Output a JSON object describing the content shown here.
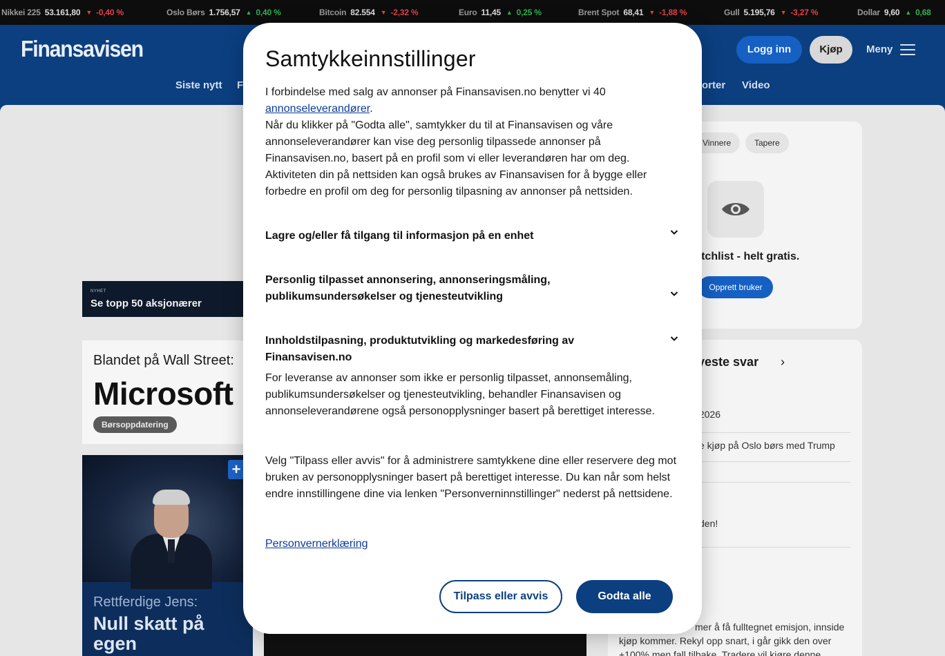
{
  "ticker": [
    {
      "name": "Nikkei 225",
      "value": "53.161,80",
      "change": "-0,40 %",
      "direction": "down"
    },
    {
      "name": "Oslo Børs",
      "value": "1.756,57",
      "change": "0,40 %",
      "direction": "up"
    },
    {
      "name": "Bitcoin",
      "value": "82.554",
      "change": "-2,32 %",
      "direction": "down"
    },
    {
      "name": "Euro",
      "value": "11,45",
      "change": "0,25 %",
      "direction": "up"
    },
    {
      "name": "Brent Spot",
      "value": "68,41",
      "change": "-1,88 %",
      "direction": "down"
    },
    {
      "name": "Gull",
      "value": "5.195,76",
      "change": "-3,27 %",
      "direction": "down"
    },
    {
      "name": "Dollar",
      "value": "9,60",
      "change": "0,68",
      "direction": "up"
    }
  ],
  "header": {
    "logo": "Finansavisen",
    "login_label": "Logg inn",
    "buy_label": "Kjøp",
    "menu_label": "Meny",
    "nav": [
      "Siste nytt",
      "F",
      "orter",
      "Video"
    ]
  },
  "promo": {
    "kicker": "NYHET",
    "title": "Se topp 50 aksjonærer"
  },
  "card1": {
    "kicker": "Blandet på Wall Street:",
    "title": "Microsoft",
    "tag": "Børsoppdatering"
  },
  "card2": {
    "badge": "+",
    "kicker": "Rettferdige Jens:",
    "title": "Null skatt på egen kjempeformue"
  },
  "watchlist": {
    "chips": [
      "Vinnere",
      "Tapere"
    ],
    "text": "en watchlist - helt gratis.",
    "button": "Opprett bruker"
  },
  "forum": {
    "title": "yeste svar",
    "rows": [
      "/2026",
      "e kjøp på Oslo børs med Trump",
      "den!",
      "mer å få fulltegnet emisjon, innside kjøp kommer. Rekyl opp snart, i går gikk den over +100% men fall tilbake. Tradere vil kjøre denne"
    ]
  },
  "consent": {
    "title": "Samtykkeinnstillinger",
    "intro_pre": "I forbindelse med salg av annonser på Finansavisen.no benytter vi 40 ",
    "intro_link": "annonseleverandører",
    "intro_post": ".",
    "intro_body": "Når du klikker på \"Godta alle\", samtykker du til at Finansavisen og våre annonseleverandører kan vise deg personlig tilpassede annonser på Finansavisen.no, basert på en profil som vi eller leverandøren har om deg. Aktiviteten din på nettsiden kan også brukes av Finansavisen for å bygge eller forbedre en profil om deg for personlig tilpasning av annonser på nettsiden.",
    "sections": [
      "Lagre og/eller få tilgang til informasjon på en enhet",
      "Personlig tilpasset annonsering, annonseringsmåling, publikumsundersøkelser og tjenesteutvikling",
      "Innholdstilpasning, produktutvikling og markedesføring av Finansavisen.no"
    ],
    "para1": "For leveranse av annonser som ikke er personlig tilpasset, annonsemåling, publikumsundersøkelser og tjenesteutvikling, behandler Finansavisen og annonseleverandørene også personopplysninger basert på berettiget interesse.",
    "para2": "Velg \"Tilpass eller avvis\" for å administrere samtykkene dine eller reservere deg mot bruken av personopplysninger basert på berettiget interesse. Du kan når som helst endre innstillingene dine via lenken \"Personverninnstillinger\" nederst på nettsidene.",
    "privacy_link": "Personvernerklæring",
    "customize_label": "Tilpass eller avvis",
    "accept_label": "Godta alle"
  }
}
